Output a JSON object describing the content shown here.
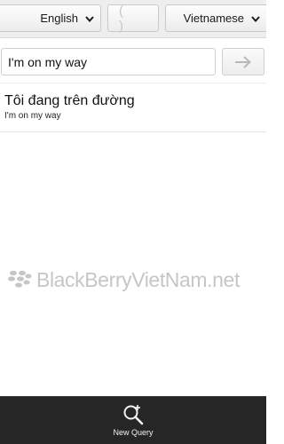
{
  "language_bar": {
    "source_language": "English",
    "swap_label": "( )",
    "target_language": "Vietnamese"
  },
  "query": {
    "input_value": "I'm on my way",
    "go_icon": "arrow-right-icon"
  },
  "result": {
    "translation": "Tôi đang trên đường",
    "source_text": "I'm on my way"
  },
  "watermark": {
    "text": "BlackBerryVietNam.net",
    "logo_icon": "blackberry-logo-icon"
  },
  "action_bar": {
    "new_query_label": "New Query",
    "new_query_icon": "search-plus-icon"
  },
  "colors": {
    "action_bar_background": "#262626",
    "watermark_text": "#c6c6c6",
    "top_bar_background": "#eeeeee"
  }
}
